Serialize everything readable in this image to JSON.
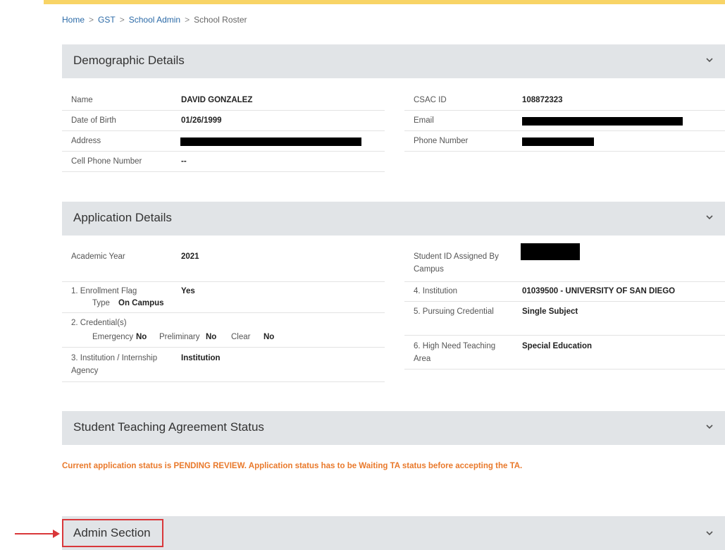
{
  "breadcrumb": {
    "home": "Home",
    "gst": "GST",
    "school_admin": "School Admin",
    "current": "School Roster",
    "separator": ">"
  },
  "demographic": {
    "title": "Demographic Details",
    "name_label": "Name",
    "name_value": "DAVID GONZALEZ",
    "dob_label": "Date of Birth",
    "dob_value": "01/26/1999",
    "address_label": "Address",
    "cell_label": "Cell Phone Number",
    "cell_value": "--",
    "csac_label": "CSAC ID",
    "csac_value": "108872323",
    "email_label": "Email",
    "phone_label": "Phone Number"
  },
  "application": {
    "title": "Application Details",
    "year_label": "Academic Year",
    "year_value": "2021",
    "enroll_label": "1. Enrollment Flag",
    "enroll_value": "Yes",
    "type_label": "Type",
    "type_value": "On Campus",
    "cred_label": "2. Credential(s)",
    "emergency_label": "Emergency",
    "emergency_value": "No",
    "preliminary_label": "Preliminary",
    "preliminary_value": "No",
    "clear_label": "Clear",
    "clear_value": "No",
    "inst_agency_label_1": "3. Institution / Internship",
    "inst_agency_label_2": "Agency",
    "inst_agency_value": "Institution",
    "student_id_label_1": "Student ID Assigned By",
    "student_id_label_2": "Campus",
    "institution_label": "4. Institution",
    "institution_value": "01039500 - UNIVERSITY OF SAN DIEGO",
    "pursuing_label": "5. Pursuing Credential",
    "pursuing_value": "Single Subject",
    "high_need_label_1": "6. High Need Teaching",
    "high_need_label_2": "Area",
    "high_need_value": "Special Education"
  },
  "teaching_agreement": {
    "title": "Student Teaching Agreement Status",
    "message": "Current application status is PENDING REVIEW. Application status has to be Waiting TA status before accepting the TA."
  },
  "admin": {
    "title": "Admin Section"
  },
  "colors": {
    "accent_bar": "#f8d466",
    "link": "#2b6aa7",
    "warning_text": "#e9792b",
    "highlight_red": "#d9373a",
    "panel_bg": "#e1e4e7"
  },
  "icons": {
    "panel_toggle": "chevron-down-icon",
    "annotation_arrow": "arrow-right-icon"
  }
}
